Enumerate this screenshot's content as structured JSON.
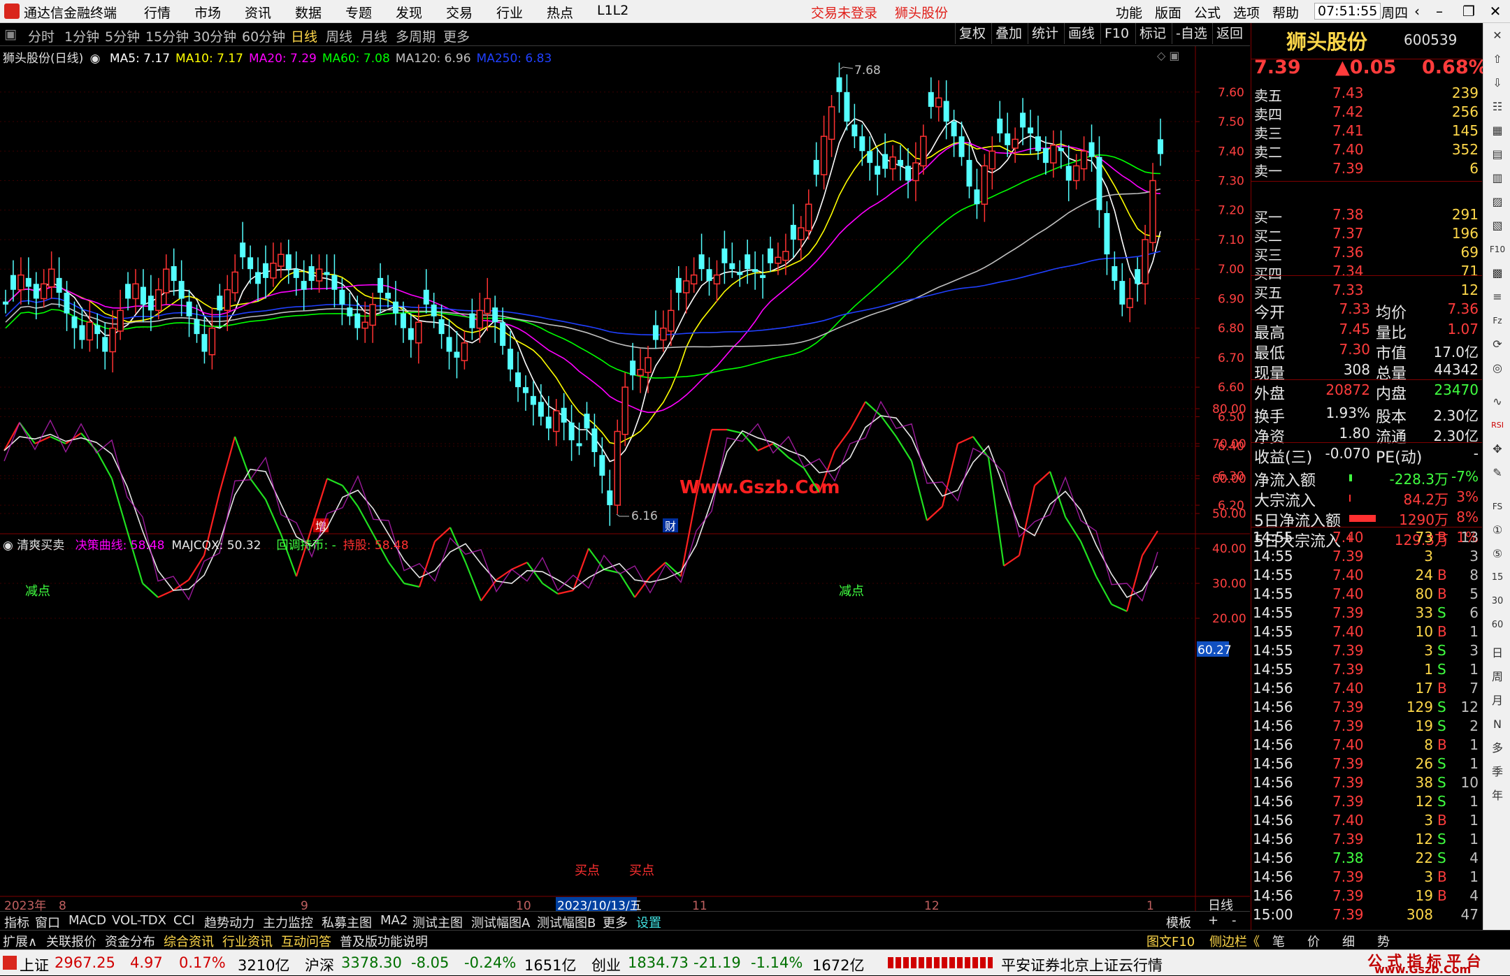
{
  "app": {
    "title": "通达信金融终端",
    "menu": [
      "行情",
      "市场",
      "资讯",
      "数据",
      "专题",
      "发现",
      "交易",
      "行业",
      "热点",
      "L1L2"
    ],
    "trade_status": "交易未登录",
    "stock_link": "狮头股份",
    "right_menu": [
      "功能",
      "版面",
      "公式",
      "选项",
      "帮助"
    ],
    "time": "07:51:55",
    "weekday": "周四"
  },
  "period_bar": {
    "items": [
      "分时",
      "1分钟",
      "5分钟",
      "15分钟",
      "30分钟",
      "60分钟",
      "日线",
      "周线",
      "月线",
      "多周期",
      "更多"
    ],
    "active": "日线",
    "tools": [
      "复权",
      "叠加",
      "统计",
      "画线",
      "F10",
      "标记",
      "-自选",
      "返回"
    ]
  },
  "main_chart": {
    "legend_name": "狮头股份(日线)",
    "ma_labels": [
      {
        "text": "MA5: 7.17",
        "color": "#ffffff"
      },
      {
        "text": "MA10: 7.17",
        "color": "#ffff00"
      },
      {
        "text": "MA20: 7.29",
        "color": "#ff00ff"
      },
      {
        "text": "MA60: 7.08",
        "color": "#00ff00"
      },
      {
        "text": "MA120: 6.96",
        "color": "#c0c0c0"
      },
      {
        "text": "MA250: 6.83",
        "color": "#2040ff"
      }
    ],
    "high_label": "7.68",
    "low_label": "6.16",
    "watermark": "Www.Gszb.Com",
    "tag_zeng": "增",
    "tag_cai": "财"
  },
  "indicator": {
    "name": "清爽买卖",
    "labels": [
      {
        "text": "决策曲线: 58.48",
        "color": "#ff00ff"
      },
      {
        "text": "MAJCQX: 50.32",
        "color": "#e8e8e8"
      },
      {
        "text": "回调持币: -",
        "color": "#40ff40"
      },
      {
        "text": "持股: 58.48",
        "color": "#ff3030"
      }
    ],
    "jiandian": "减点",
    "maidian": "买点",
    "current_value": "60.27"
  },
  "x_axis": {
    "labels": [
      "2023年",
      "8",
      "9",
      "10",
      "2023/10/13/五",
      "11",
      "12",
      "1"
    ],
    "period": "日线"
  },
  "chart_data": [
    {
      "type": "candlestick",
      "title": "狮头股份(日线)",
      "ylim": [
        6.16,
        7.68
      ],
      "y_ticks": [
        "7.60",
        "7.50",
        "7.40",
        "7.30",
        "7.20",
        "7.10",
        "7.00",
        "6.90",
        "6.80",
        "6.70",
        "6.60",
        "6.50",
        "6.40",
        "6.30",
        "6.20"
      ],
      "series": [
        {
          "name": "MA5",
          "value": 7.17
        },
        {
          "name": "MA10",
          "value": 7.17
        },
        {
          "name": "MA20",
          "value": 7.29
        },
        {
          "name": "MA60",
          "value": 7.08
        },
        {
          "name": "MA120",
          "value": 6.96
        },
        {
          "name": "MA250",
          "value": 6.83
        }
      ],
      "annotations": [
        "7.68",
        "6.16"
      ]
    },
    {
      "type": "line",
      "title": "清爽买卖",
      "ylim": [
        15,
        85
      ],
      "y_ticks": [
        "80.00",
        "70.00",
        "60.00",
        "50.00",
        "40.00",
        "30.00",
        "20.00"
      ],
      "series": [
        {
          "name": "决策曲线",
          "value": 58.48
        },
        {
          "name": "MAJCQX",
          "value": 50.32
        }
      ]
    }
  ],
  "quote": {
    "name": "狮头股份",
    "code": "600539",
    "price": "7.39",
    "change": "▲0.05",
    "change_pct": "0.68%",
    "asks": [
      {
        "label": "卖五",
        "price": "7.43",
        "vol": "239"
      },
      {
        "label": "卖四",
        "price": "7.42",
        "vol": "256"
      },
      {
        "label": "卖三",
        "price": "7.41",
        "vol": "145"
      },
      {
        "label": "卖二",
        "price": "7.40",
        "vol": "352"
      },
      {
        "label": "卖一",
        "price": "7.39",
        "vol": "6"
      }
    ],
    "bids": [
      {
        "label": "买一",
        "price": "7.38",
        "vol": "291"
      },
      {
        "label": "买二",
        "price": "7.37",
        "vol": "196"
      },
      {
        "label": "买三",
        "price": "7.36",
        "vol": "69"
      },
      {
        "label": "买四",
        "price": "7.34",
        "vol": "71"
      },
      {
        "label": "买五",
        "price": "7.33",
        "vol": "12"
      }
    ],
    "stats": [
      {
        "l1": "今开",
        "v1": "7.33",
        "c1": "red",
        "l2": "均价",
        "v2": "7.36",
        "c2": "red"
      },
      {
        "l1": "最高",
        "v1": "7.45",
        "c1": "red",
        "l2": "量比",
        "v2": "1.07",
        "c2": "red"
      },
      {
        "l1": "最低",
        "v1": "7.30",
        "c1": "red",
        "l2": "市值",
        "v2": "17.0亿",
        "c2": "wht"
      },
      {
        "l1": "现量",
        "v1": "308",
        "c1": "wht",
        "l2": "总量",
        "v2": "44342",
        "c2": "wht"
      },
      {
        "l1": "外盘",
        "v1": "20872",
        "c1": "red",
        "l2": "内盘",
        "v2": "23470",
        "c2": "grn"
      }
    ],
    "stats2": [
      {
        "l1": "换手",
        "v1": "1.93%",
        "l2": "股本",
        "v2": "2.30亿"
      },
      {
        "l1": "净资",
        "v1": "1.80",
        "l2": "流通",
        "v2": "2.30亿"
      },
      {
        "l1": "收益(三)",
        "v1": "-0.070",
        "l2": "PE(动)",
        "v2": "-"
      }
    ],
    "flows": [
      {
        "label": "净流入额",
        "val": "-228.3万",
        "pct": "-7%",
        "c": "grn"
      },
      {
        "label": "大宗流入",
        "val": "84.2万",
        "pct": "3%",
        "c": "red"
      },
      {
        "label": "5日净流入额",
        "val": "1290万",
        "pct": "8%",
        "c": "red"
      },
      {
        "label": "5日大宗流入",
        "val": "129.3万",
        "pct": "1%",
        "c": "red"
      }
    ],
    "ticks": [
      {
        "t": "14:55",
        "p": "7.40",
        "v": "73",
        "s": "B",
        "n": "13"
      },
      {
        "t": "14:55",
        "p": "7.39",
        "v": "3",
        "s": "",
        "n": "3"
      },
      {
        "t": "14:55",
        "p": "7.40",
        "v": "24",
        "s": "B",
        "n": "8"
      },
      {
        "t": "14:55",
        "p": "7.40",
        "v": "80",
        "s": "B",
        "n": "5"
      },
      {
        "t": "14:55",
        "p": "7.39",
        "v": "33",
        "s": "S",
        "n": "6"
      },
      {
        "t": "14:55",
        "p": "7.40",
        "v": "10",
        "s": "B",
        "n": "1"
      },
      {
        "t": "14:55",
        "p": "7.39",
        "v": "3",
        "s": "S",
        "n": "3"
      },
      {
        "t": "14:55",
        "p": "7.39",
        "v": "1",
        "s": "S",
        "n": "1"
      },
      {
        "t": "14:56",
        "p": "7.40",
        "v": "17",
        "s": "B",
        "n": "7"
      },
      {
        "t": "14:56",
        "p": "7.39",
        "v": "129",
        "s": "S",
        "n": "12"
      },
      {
        "t": "14:56",
        "p": "7.39",
        "v": "19",
        "s": "S",
        "n": "2"
      },
      {
        "t": "14:56",
        "p": "7.40",
        "v": "8",
        "s": "B",
        "n": "1"
      },
      {
        "t": "14:56",
        "p": "7.39",
        "v": "26",
        "s": "S",
        "n": "1"
      },
      {
        "t": "14:56",
        "p": "7.39",
        "v": "38",
        "s": "S",
        "n": "10"
      },
      {
        "t": "14:56",
        "p": "7.39",
        "v": "12",
        "s": "S",
        "n": "1"
      },
      {
        "t": "14:56",
        "p": "7.40",
        "v": "3",
        "s": "B",
        "n": "1"
      },
      {
        "t": "14:56",
        "p": "7.39",
        "v": "12",
        "s": "S",
        "n": "1"
      },
      {
        "t": "14:56",
        "p": "7.38",
        "v": "22",
        "s": "S",
        "n": "4"
      },
      {
        "t": "14:56",
        "p": "7.39",
        "v": "3",
        "s": "B",
        "n": "1"
      },
      {
        "t": "14:56",
        "p": "7.39",
        "v": "19",
        "s": "B",
        "n": "4"
      },
      {
        "t": "15:00",
        "p": "7.39",
        "v": "308",
        "s": "",
        "n": "47"
      }
    ]
  },
  "tabs": [
    "指标",
    "窗口",
    "MACD",
    "VOL-TDX",
    "CCI",
    "趋势动力",
    "主力监控",
    "私募主图",
    "MA2",
    "测试主图",
    "测试幅图A",
    "测试幅图B",
    "更多",
    "设置"
  ],
  "tab_right": [
    "模板",
    "+",
    "-"
  ],
  "ext_tabs": [
    "扩展∧",
    "关联报价",
    "资金分布",
    "综合资讯",
    "行业资讯",
    "互动问答",
    "普及版功能说明"
  ],
  "ext_right": [
    "图文F10",
    "侧边栏《",
    "笔",
    "价",
    "细",
    "势"
  ],
  "status": {
    "sh_label": "上证",
    "sh_val": "2967.25",
    "sh_chg": "4.97",
    "sh_pct": "0.17%",
    "sh_amt": "3210亿",
    "hs_label": "沪深",
    "hs_val": "3378.30",
    "hs_chg": "-8.05",
    "hs_pct": "-0.24%",
    "hs_amt": "1651亿",
    "cy_label": "创业",
    "cy_val": "1834.73",
    "cy_chg": "-21.19",
    "cy_pct": "-1.14%",
    "cy_amt": "1672亿",
    "server": "平安证券北京上证云行情",
    "brand_title": "公 式 指 标 平 台",
    "brand_url": "www.Gszb.Com"
  }
}
